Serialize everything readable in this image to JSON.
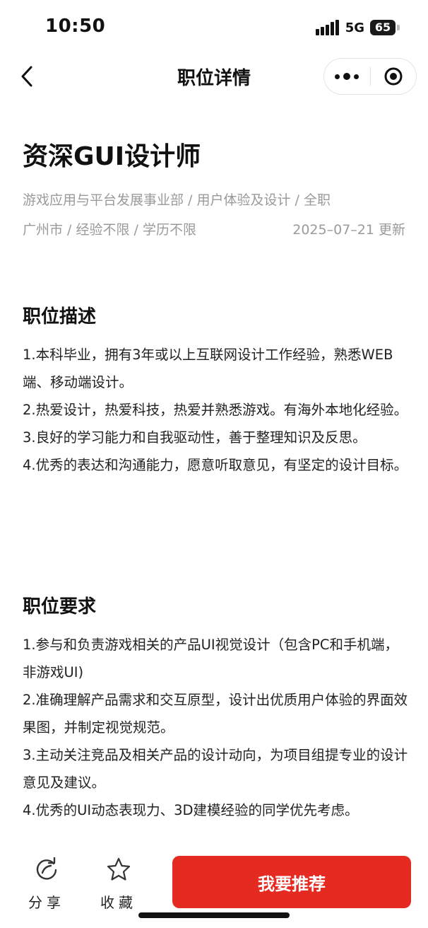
{
  "status_bar": {
    "time": "10:50",
    "network": "5G",
    "battery": "65",
    "signal_icon": "signal-bars-icon"
  },
  "nav": {
    "title": "职位详情",
    "back_icon": "chevron-left-icon",
    "more_icon": "more-dots-icon",
    "close_icon": "target-circle-icon"
  },
  "job": {
    "title": "资深GUI设计师",
    "department_line": "游戏应用与平台发展事业部 / 用户体验及设计 / 全职",
    "location_line": "广州市 / 经验不限 / 学历不限",
    "updated": "2025–07–21 更新"
  },
  "description": {
    "heading": "职位描述",
    "items": [
      "1.本科毕业，拥有3年或以上互联网设计工作经验，熟悉WEB端、移动端设计。",
      "2.热爱设计，热爱科技，热爱并熟悉游戏。有海外本地化经验。",
      "3.良好的学习能力和自我驱动性，善于整理知识及反思。",
      "4.优秀的表达和沟通能力，愿意听取意见，有坚定的设计目标。"
    ]
  },
  "requirements": {
    "heading": "职位要求",
    "items": [
      "1.参与和负责游戏相关的产品UI视觉设计（包含PC和手机端，非游戏UI)",
      "2.准确理解产品需求和交互原型，设计出优质用户体验的界面效果图，并制定视觉规范。",
      "3.主动关注竞品及相关产品的设计动向，为项目组提专业的设计意见及建议。",
      "4.优秀的UI动态表现力、3D建模经验的同学优先考虑。"
    ]
  },
  "bottom_bar": {
    "share_label": "分享",
    "favorite_label": "收藏",
    "recommend_label": "我要推荐",
    "accent_color": "#e52a21"
  }
}
